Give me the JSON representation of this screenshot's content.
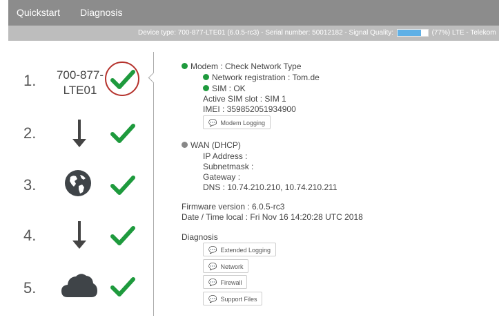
{
  "nav": {
    "tabs": [
      {
        "label": "Quickstart"
      },
      {
        "label": "Diagnosis"
      }
    ]
  },
  "infobar": {
    "prefix": "Device type: 700-877-LTE01 (6.0.5-rc3) - Serial number: 50012182  - Signal Quality:",
    "signal_percent": 77,
    "suffix": "(77%)  LTE - Telekom"
  },
  "steps": [
    {
      "num": "1.",
      "label_line1": "700-877-",
      "label_line2": "LTE01",
      "status": "ok"
    },
    {
      "num": "2.",
      "icon": "arrow-down-icon",
      "status": "ok"
    },
    {
      "num": "3.",
      "icon": "globe-icon",
      "status": "ok"
    },
    {
      "num": "4.",
      "icon": "arrow-down-icon",
      "status": "ok"
    },
    {
      "num": "5.",
      "icon": "cloud-icon",
      "status": "ok"
    }
  ],
  "colors": {
    "ok_green": "#1e9a3d",
    "gray_dot": "#888888",
    "highlight_ring": "#b5322c"
  },
  "modem": {
    "title": "Modem : Check Network Type",
    "network_registration": "Network registration : Tom.de",
    "sim": "SIM : OK",
    "active_sim_slot": "Active SIM slot : SIM 1",
    "imei": "IMEI : 359852051934900",
    "logging_button": "Modem Logging"
  },
  "wan": {
    "title": "WAN (DHCP)",
    "ip": "IP Address :",
    "subnet": "Subnetmask :",
    "gateway": "Gateway :",
    "dns": "DNS : 10.74.210.210, 10.74.210.211"
  },
  "firmware": "Firmware version : 6.0.5-rc3",
  "datetime": "Date / Time local : Fri Nov 16 14:20:28 UTC 2018",
  "diagnosis": {
    "title": "Diagnosis",
    "buttons": [
      "Extended Logging",
      "Network",
      "Firewall",
      "Support Files"
    ]
  }
}
